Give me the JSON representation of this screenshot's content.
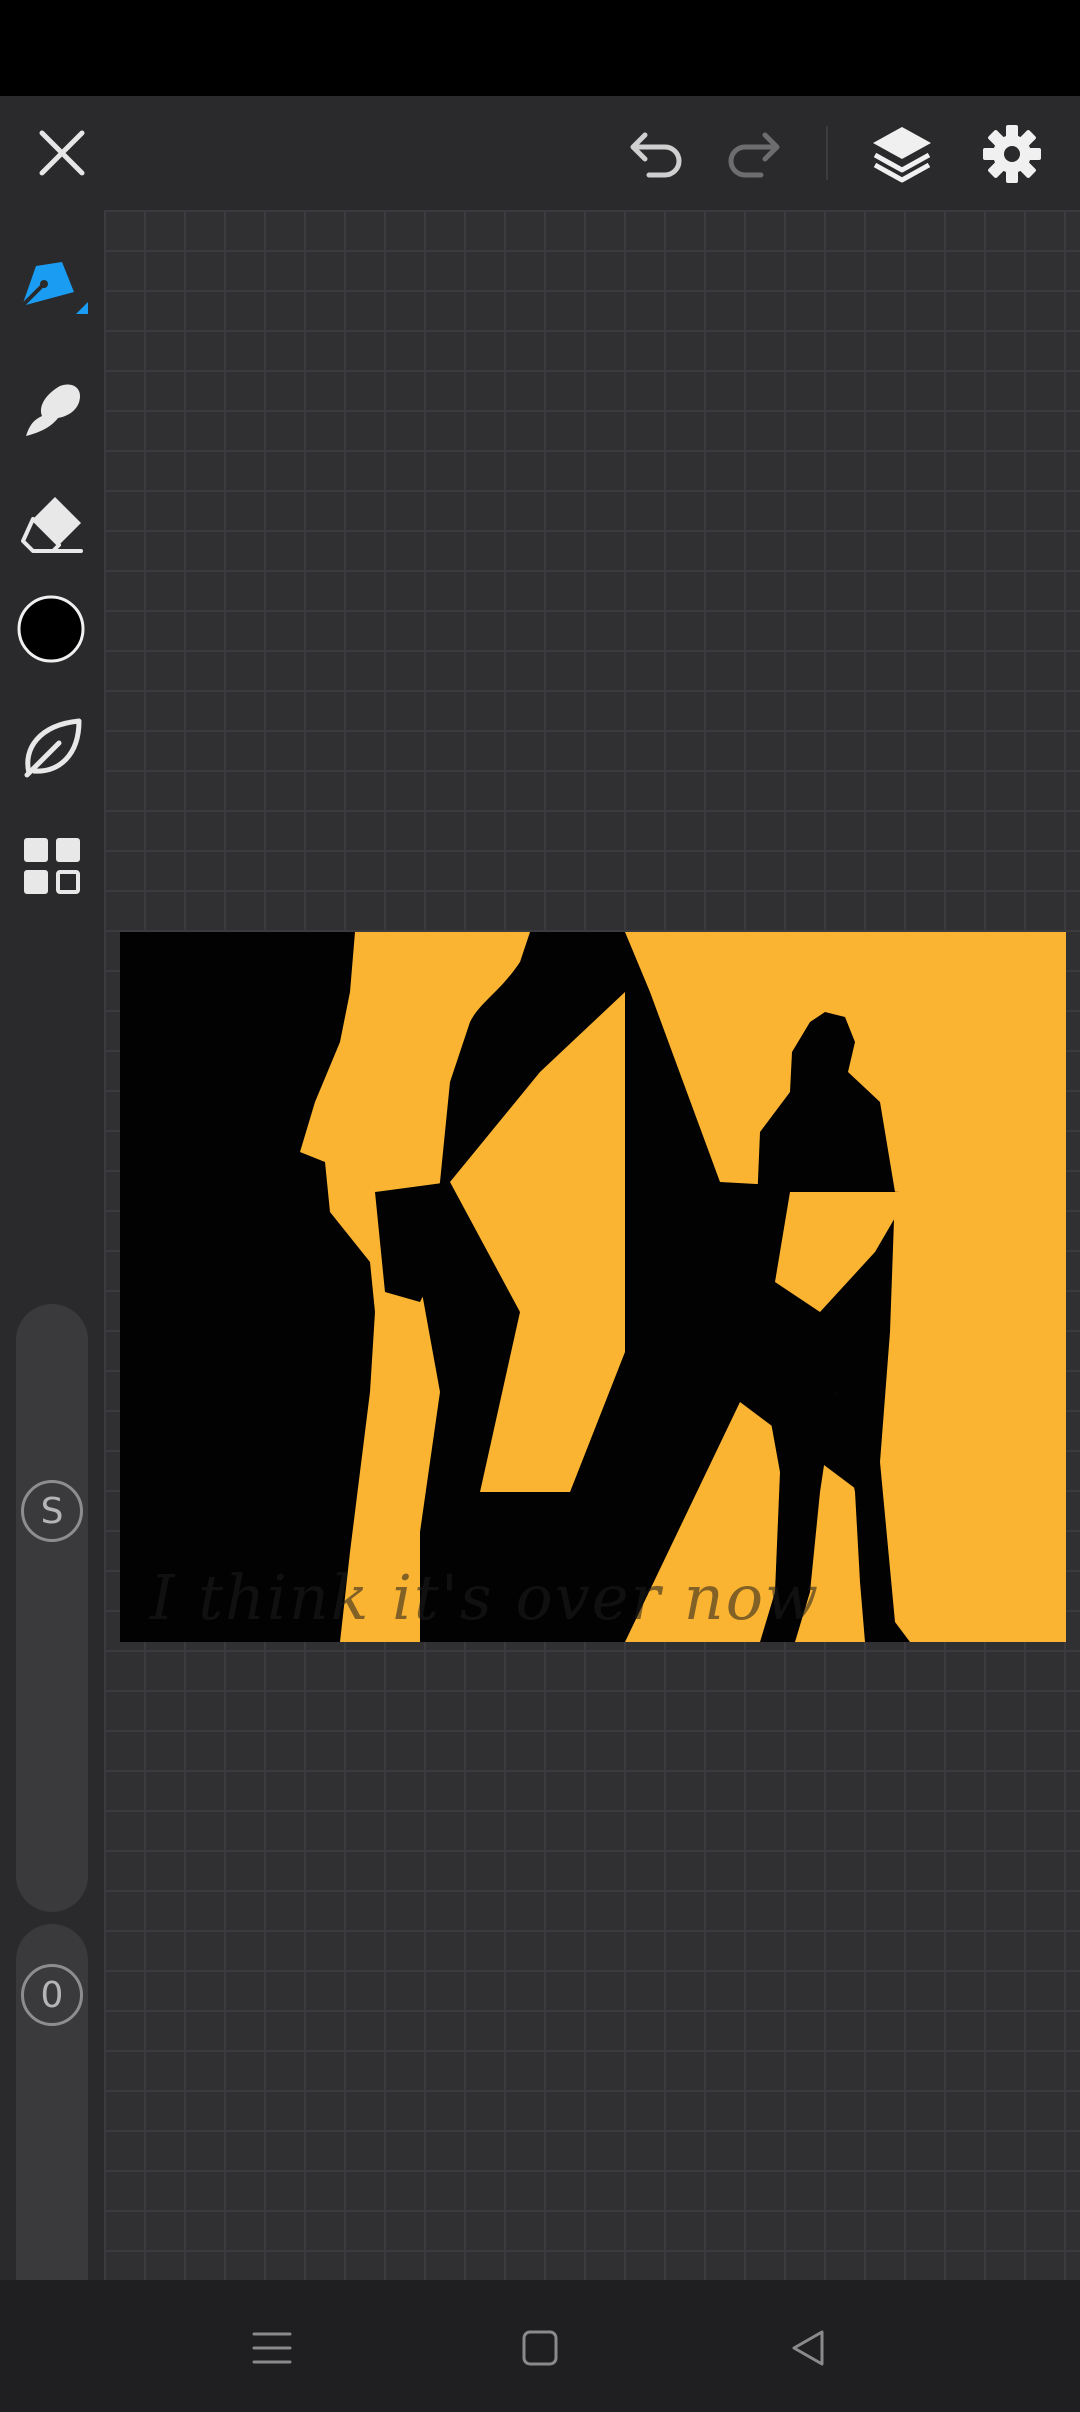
{
  "app": {
    "icons": {
      "close": "close-icon",
      "undo": "undo-icon",
      "redo": "redo-icon",
      "layers": "layers-icon",
      "settings": "gear-icon",
      "pen": "pen-icon",
      "smudge": "smudge-icon",
      "eraser": "eraser-icon",
      "color": "color-swatch-icon",
      "leaf": "leaf-brush-icon",
      "grid": "grid-icon"
    },
    "colors": {
      "accent": "#1a9cf2",
      "current_color": "#000000",
      "artwork_yellow": "#fbb432"
    }
  },
  "sidebar": {
    "size_value": "S",
    "opacity_value": "0"
  },
  "canvas": {
    "caption": "I think it's over now"
  },
  "nav": {
    "menu": "menu-icon",
    "home": "home-icon",
    "back": "back-icon"
  }
}
